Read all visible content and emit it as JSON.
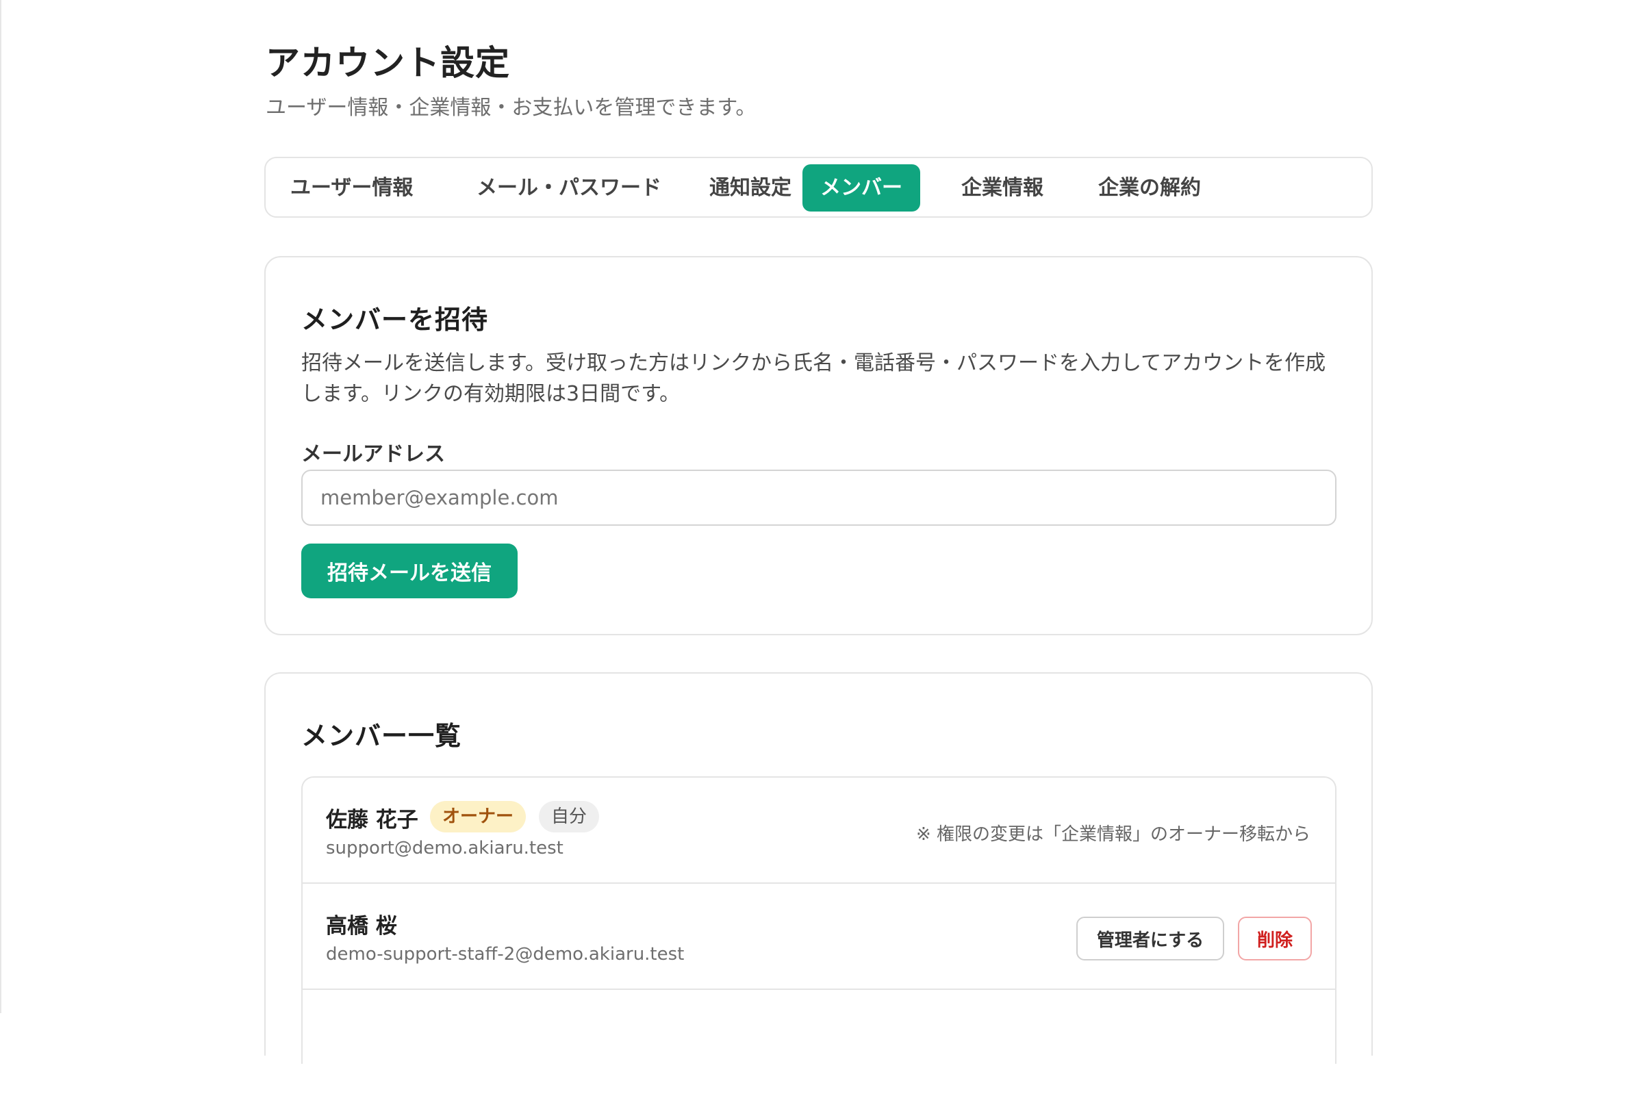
{
  "page": {
    "title": "アカウント設定",
    "subtitle": "ユーザー情報・企業情報・お支払いを管理できます。"
  },
  "tabs": [
    {
      "label": "ユーザー情報",
      "active": false
    },
    {
      "label": "メール・パスワード",
      "active": false
    },
    {
      "label": "通知設定",
      "active": false
    },
    {
      "label": "メンバー",
      "active": true
    },
    {
      "label": "企業情報",
      "active": false
    },
    {
      "label": "企業の解約",
      "active": false
    }
  ],
  "invite": {
    "title": "メンバーを招待",
    "description": "招待メールを送信します。受け取った方はリンクから氏名・電話番号・パスワードを入力してアカウントを作成します。リンクの有効期限は3日間です。",
    "email_label": "メールアドレス",
    "email_placeholder": "member@example.com",
    "email_value": "",
    "send_label": "招待メールを送信"
  },
  "members": {
    "title": "メンバー一覧",
    "rows": [
      {
        "name": "佐藤 花子",
        "email": "support@demo.akiaru.test",
        "badge_owner": "オーナー",
        "badge_self": "自分",
        "note": "※ 権限の変更は「企業情報」のオーナー移転から"
      },
      {
        "name": "高橋 桜",
        "email": "demo-support-staff-2@demo.akiaru.test",
        "make_admin_label": "管理者にする",
        "delete_label": "削除"
      }
    ]
  },
  "colors": {
    "accent": "#10a57f",
    "owner_badge_bg": "#fdf1c6",
    "owner_badge_text": "#a0520d",
    "danger": "#d0201f"
  }
}
